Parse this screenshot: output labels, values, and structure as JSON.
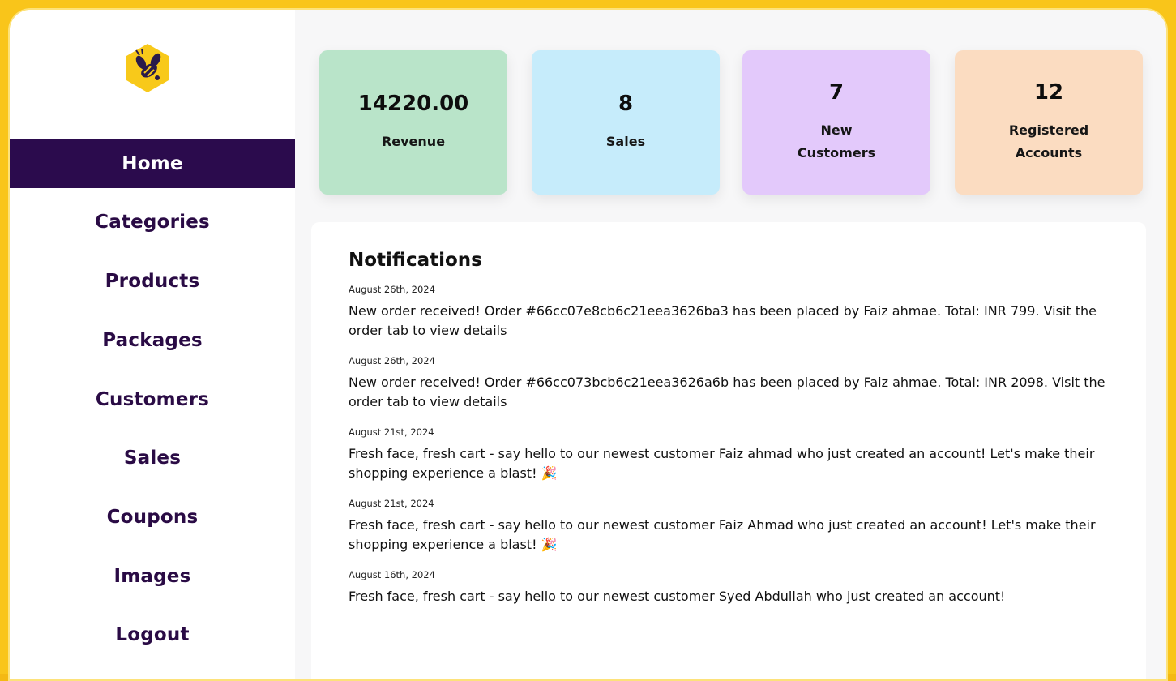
{
  "sidebar": {
    "logo": "bee-logo",
    "items": [
      {
        "label": "Home",
        "active": true
      },
      {
        "label": "Categories",
        "active": false
      },
      {
        "label": "Products",
        "active": false
      },
      {
        "label": "Packages",
        "active": false
      },
      {
        "label": "Customers",
        "active": false
      },
      {
        "label": "Sales",
        "active": false
      },
      {
        "label": "Coupons",
        "active": false
      },
      {
        "label": "Images",
        "active": false
      },
      {
        "label": "Logout",
        "active": false
      }
    ]
  },
  "stats": [
    {
      "value": "14220.00",
      "label": "Revenue",
      "color": "#b9e4c9"
    },
    {
      "value": "8",
      "label": "Sales",
      "color": "#c6ecfb"
    },
    {
      "value": "7",
      "label": "New Customers",
      "color": "#e3c9fb"
    },
    {
      "value": "12",
      "label": "Registered Accounts",
      "color": "#fbdcc1"
    }
  ],
  "notifications": {
    "title": "Notifications",
    "items": [
      {
        "date": "August 26th, 2024",
        "message": "New order received! Order #66cc07e8cb6c21eea3626ba3 has been placed by Faiz ahmae. Total: INR 799. Visit the order tab to view details"
      },
      {
        "date": "August 26th, 2024",
        "message": "New order received! Order #66cc073bcb6c21eea3626a6b has been placed by Faiz ahmae. Total: INR 2098. Visit the order tab to view details"
      },
      {
        "date": "August 21st, 2024",
        "message": "Fresh face, fresh cart - say hello to our newest customer Faiz ahmad who just created an account! Let's make their shopping experience a blast! 🎉"
      },
      {
        "date": "August 21st, 2024",
        "message": "Fresh face, fresh cart - say hello to our newest customer Faiz Ahmad who just created an account! Let's make their shopping experience a blast! 🎉"
      },
      {
        "date": "August 16th, 2024",
        "message": "Fresh face, fresh cart - say hello to our newest customer Syed Abdullah who just created an account!"
      }
    ]
  },
  "colors": {
    "frame": "#f9c51a",
    "sidebar_active": "#2b0b4d",
    "nav_text": "#2a0b45"
  }
}
